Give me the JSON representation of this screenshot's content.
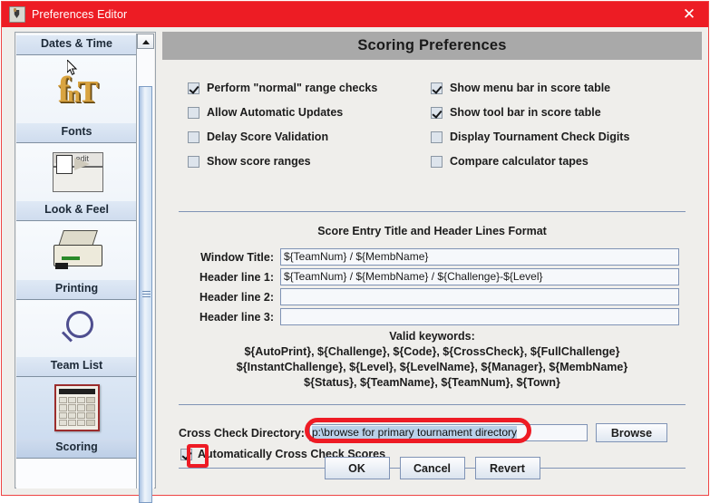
{
  "window": {
    "title": "Preferences Editor",
    "close_label": "✕",
    "icon": "java-coffee-cup-icon",
    "accent_color": "#ed1c24"
  },
  "sidebar": {
    "items": [
      {
        "label": "Dates & Time",
        "icon": "dates-time-icon",
        "selected": false
      },
      {
        "label": "Fonts",
        "icon": "fonts-icon",
        "selected": false
      },
      {
        "label": "Look & Feel",
        "icon": "look-and-feel-icon",
        "selected": false
      },
      {
        "label": "Printing",
        "icon": "printer-icon",
        "selected": false
      },
      {
        "label": "Team List",
        "icon": "magnifier-icon",
        "selected": false
      },
      {
        "label": "Scoring",
        "icon": "calculator-icon",
        "selected": true
      }
    ],
    "scrollbar": {
      "up_arrow": "scroll-up-arrow-icon"
    }
  },
  "main": {
    "header_title": "Scoring Preferences",
    "checkboxes": {
      "rows": [
        {
          "left": {
            "label": "Perform \"normal\" range checks",
            "checked": true
          },
          "right": {
            "label": "Show menu bar in score table",
            "checked": true
          }
        },
        {
          "left": {
            "label": "Allow Automatic Updates",
            "checked": false
          },
          "right": {
            "label": "Show tool bar in score table",
            "checked": true
          }
        },
        {
          "left": {
            "label": "Delay Score Validation",
            "checked": false
          },
          "right": {
            "label": "Display Tournament Check Digits",
            "checked": false
          }
        },
        {
          "left": {
            "label": "Show score ranges",
            "checked": false
          },
          "right": {
            "label": "Compare calculator tapes",
            "checked": false
          }
        }
      ]
    },
    "format_section": {
      "title": "Score Entry Title and Header Lines Format",
      "fields": [
        {
          "label": "Window Title:",
          "value": "${TeamNum} / ${MembName}"
        },
        {
          "label": "Header line 1:",
          "value": "${TeamNum} / ${MembName} / ${Challenge}-${Level}"
        },
        {
          "label": "Header line 2:",
          "value": ""
        },
        {
          "label": "Header line 3:",
          "value": ""
        }
      ],
      "keywords_title": "Valid keywords:",
      "keywords_lines": [
        "${AutoPrint}, ${Challenge}, ${Code}, ${CrossCheck}, ${FullChallenge}",
        "${InstantChallenge}, ${Level}, ${LevelName}, ${Manager}, ${MembName}",
        "${Status}, ${TeamName}, ${TeamNum}, ${Town}"
      ]
    },
    "cross_check": {
      "label": "Cross Check Directory:",
      "value": "p:\\browse for primary tournament directory",
      "value_selected": true,
      "browse_label": "Browse",
      "auto_checkbox": {
        "label": "Automatically Cross Check Scores",
        "checked": true
      }
    },
    "buttons": [
      {
        "label": "OK"
      },
      {
        "label": "Cancel"
      },
      {
        "label": "Revert"
      }
    ]
  },
  "annotations": {
    "highlight_color": "#ee1b24",
    "shapes": [
      "oval-around-cross-check-directory-field",
      "box-around-auto-cross-check-checkbox"
    ]
  }
}
